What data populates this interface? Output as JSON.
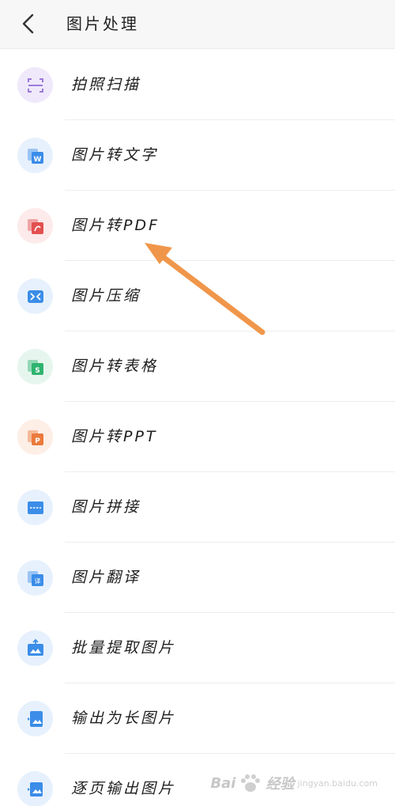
{
  "header": {
    "title": "图片处理"
  },
  "items": [
    {
      "label": "拍照扫描",
      "icon": "scan-icon",
      "bg": "#efe9fb",
      "color": "#9b7bdc"
    },
    {
      "label": "图片转文字",
      "icon": "word-doc-icon",
      "bg": "#e7f1fd",
      "color": "#3b8de8"
    },
    {
      "label": "图片转PDF",
      "icon": "pdf-doc-icon",
      "bg": "#fdeaea",
      "color": "#e2504f"
    },
    {
      "label": "图片压缩",
      "icon": "compress-icon",
      "bg": "#e7f1fd",
      "color": "#3b8de8"
    },
    {
      "label": "图片转表格",
      "icon": "sheet-doc-icon",
      "bg": "#e6f6ee",
      "color": "#2fb46f"
    },
    {
      "label": "图片转PPT",
      "icon": "ppt-doc-icon",
      "bg": "#fdeee6",
      "color": "#ec7a3c"
    },
    {
      "label": "图片拼接",
      "icon": "stitch-icon",
      "bg": "#e7f1fd",
      "color": "#3b8de8"
    },
    {
      "label": "图片翻译",
      "icon": "translate-icon",
      "bg": "#e7f1fd",
      "color": "#3b8de8"
    },
    {
      "label": "批量提取图片",
      "icon": "extract-image-icon",
      "bg": "#e7f1fd",
      "color": "#3b8de8"
    },
    {
      "label": "输出为长图片",
      "icon": "long-image-icon",
      "bg": "#e7f1fd",
      "color": "#3b8de8"
    },
    {
      "label": "逐页输出图片",
      "icon": "page-image-icon",
      "bg": "#e7f1fd",
      "color": "#3b8de8"
    }
  ],
  "annotation": {
    "arrow_color": "#f0964a"
  },
  "watermark": {
    "text": "Bai",
    "text2": "经验",
    "sub": "jingyan.baidu.com"
  }
}
